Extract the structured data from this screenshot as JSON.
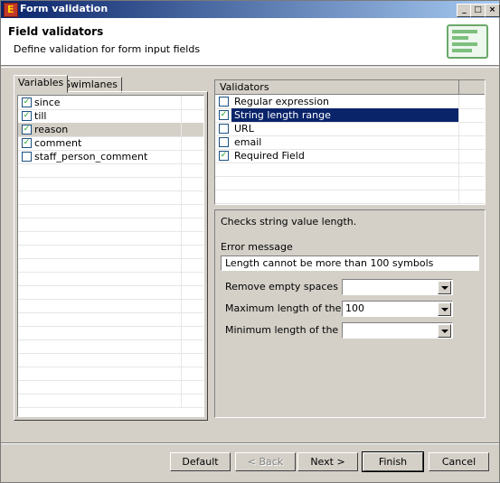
{
  "window": {
    "title": "Form validation"
  },
  "header": {
    "title": "Field validators",
    "description": "Define validation for form input fields"
  },
  "tabs": [
    {
      "label": "Variables"
    },
    {
      "label": "Swimlanes"
    }
  ],
  "variables": [
    {
      "label": "since",
      "checked": true
    },
    {
      "label": "till",
      "checked": true
    },
    {
      "label": "reason",
      "checked": true,
      "selected": true
    },
    {
      "label": "comment",
      "checked": true
    },
    {
      "label": "staff_person_comment",
      "checked": false
    }
  ],
  "validators": {
    "header": "Validators",
    "items": [
      {
        "label": "Regular expression",
        "checked": false
      },
      {
        "label": "String length range",
        "checked": true,
        "selected": true
      },
      {
        "label": "URL",
        "checked": false
      },
      {
        "label": "email",
        "checked": false
      },
      {
        "label": "Required Field",
        "checked": true
      }
    ]
  },
  "detail": {
    "description": "Checks string value length.",
    "error_label": "Error message",
    "error_value": "Length cannot be more than 100 symbols",
    "fields": [
      {
        "label": "Remove empty spaces (trim)",
        "value": ""
      },
      {
        "label": "Maximum length of the string",
        "value": "100"
      },
      {
        "label": "Minimum length of the string",
        "value": ""
      }
    ]
  },
  "buttons": {
    "default": "Default",
    "back": "< Back",
    "next": "Next >",
    "finish": "Finish",
    "cancel": "Cancel"
  },
  "colors": {
    "selection": "#0a246a",
    "title_bar": "#0a246a",
    "check": "#21a121"
  }
}
